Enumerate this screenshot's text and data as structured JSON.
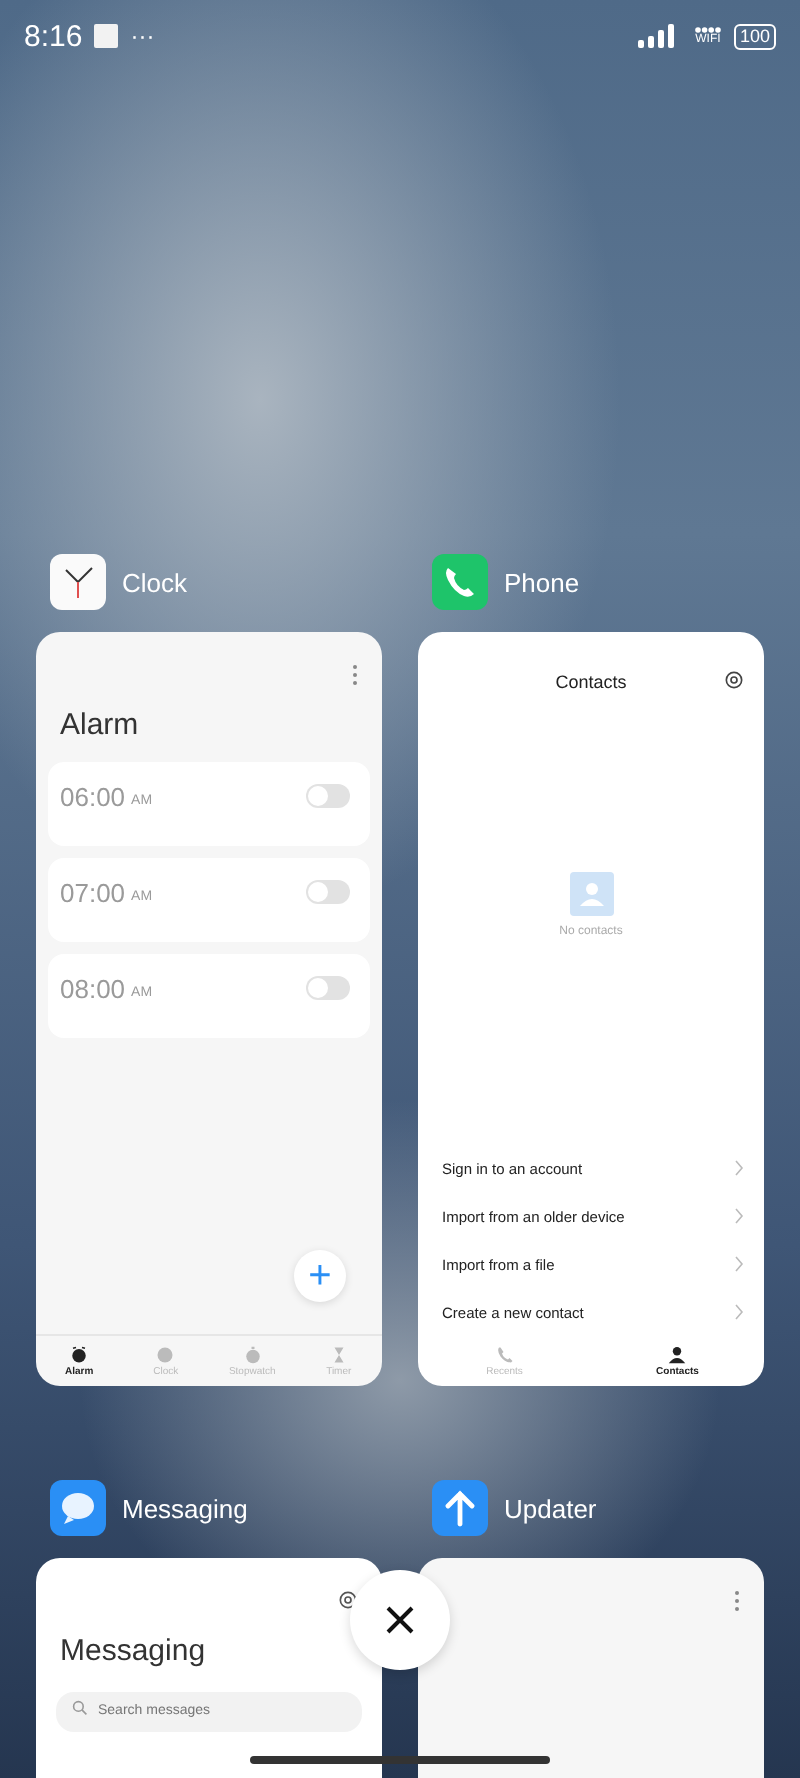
{
  "status_bar": {
    "time": "8:16",
    "more": "···",
    "wifi_label": "WIFI",
    "battery": "100"
  },
  "apps": [
    {
      "kind": "clock",
      "name": "Clock",
      "title": "Alarm",
      "alarms": [
        {
          "time": "06:00",
          "ampm": "AM",
          "on": false
        },
        {
          "time": "07:00",
          "ampm": "AM",
          "on": false
        },
        {
          "time": "08:00",
          "ampm": "AM",
          "on": false
        }
      ],
      "add": "+",
      "tabs": [
        {
          "label": "Alarm",
          "selected": true
        },
        {
          "label": "Clock",
          "selected": false
        },
        {
          "label": "Stopwatch",
          "selected": false
        },
        {
          "label": "Timer",
          "selected": false
        }
      ]
    },
    {
      "kind": "phone",
      "name": "Phone",
      "title": "Contacts",
      "empty": "No contacts",
      "actions": [
        "Sign in to an account",
        "Import from an older device",
        "Import from a file",
        "Create a new contact"
      ],
      "tabs": [
        {
          "label": "Recents",
          "selected": false
        },
        {
          "label": "Contacts",
          "selected": true
        }
      ]
    },
    {
      "kind": "messaging",
      "name": "Messaging",
      "title": "Messaging",
      "search_placeholder": "Search messages"
    },
    {
      "kind": "updater",
      "name": "Updater"
    }
  ]
}
